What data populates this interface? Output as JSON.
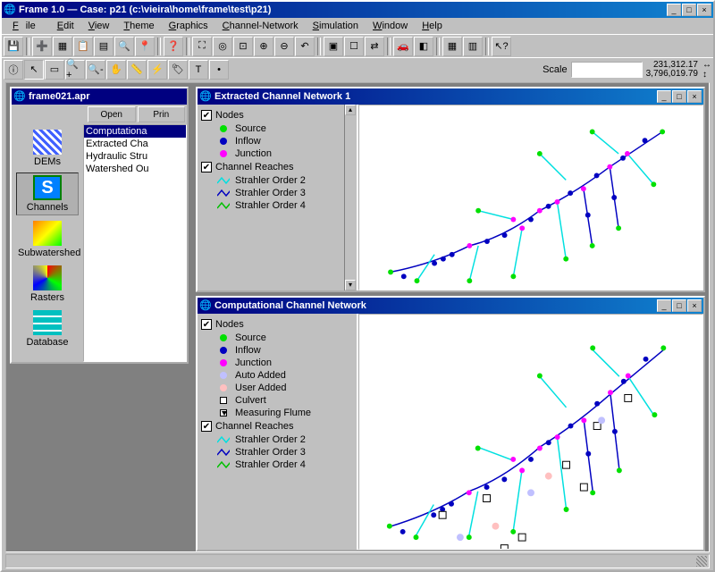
{
  "title": "Frame 1.0  —  Case: p21 (c:\\vieira\\home\\frame\\test\\p21)",
  "menu": [
    "File",
    "Edit",
    "View",
    "Theme",
    "Graphics",
    "Channel-Network",
    "Simulation",
    "Window",
    "Help"
  ],
  "scale_label": "Scale",
  "coord_top": "231,312.17",
  "coord_bot": "3,796,019.79",
  "project": {
    "title": "frame021.apr",
    "open_btn": "Open",
    "print_btn": "Prin",
    "tabs": [
      "DEMs",
      "Channels",
      "Subwatershed",
      "Rasters",
      "Database"
    ],
    "tab_selected": "Channels",
    "items": [
      "Computationa",
      "Extracted Cha",
      "Hydraulic Stru",
      "Watershed Ou"
    ],
    "item_selected": 0
  },
  "win1": {
    "title": "Extracted Channel Network 1",
    "nodes_hdr": "Nodes",
    "reaches_hdr": "Channel Reaches",
    "nodes": [
      {
        "label": "Source",
        "color": "#00e000"
      },
      {
        "label": "Inflow",
        "color": "#0000c0"
      },
      {
        "label": "Junction",
        "color": "#ff00ff"
      }
    ],
    "reaches": [
      {
        "label": "Strahler Order 2",
        "color": "#00e0e0"
      },
      {
        "label": "Strahler Order 3",
        "color": "#0000c0"
      },
      {
        "label": "Strahler Order 4",
        "color": "#00c000"
      }
    ]
  },
  "win2": {
    "title": "Computational Channel Network",
    "nodes_hdr": "Nodes",
    "reaches_hdr": "Channel Reaches",
    "nodes": [
      {
        "label": "Source",
        "color": "#00e000",
        "shape": "dot"
      },
      {
        "label": "Inflow",
        "color": "#0000c0",
        "shape": "dot"
      },
      {
        "label": "Junction",
        "color": "#ff00ff",
        "shape": "dot"
      },
      {
        "label": "Auto Added",
        "color": "#c0c0ff",
        "shape": "dot"
      },
      {
        "label": "User Added",
        "color": "#ffc0c0",
        "shape": "dot"
      },
      {
        "label": "Culvert",
        "color": "#fff",
        "shape": "sq"
      },
      {
        "label": "Measuring Flume",
        "color": "#fff",
        "shape": "sq-tri"
      }
    ],
    "reaches": [
      {
        "label": "Strahler Order 2",
        "color": "#00e0e0"
      },
      {
        "label": "Strahler Order 3",
        "color": "#0000c0"
      },
      {
        "label": "Strahler Order 4",
        "color": "#00c000"
      }
    ]
  },
  "icons": {
    "geo": "🌐"
  }
}
